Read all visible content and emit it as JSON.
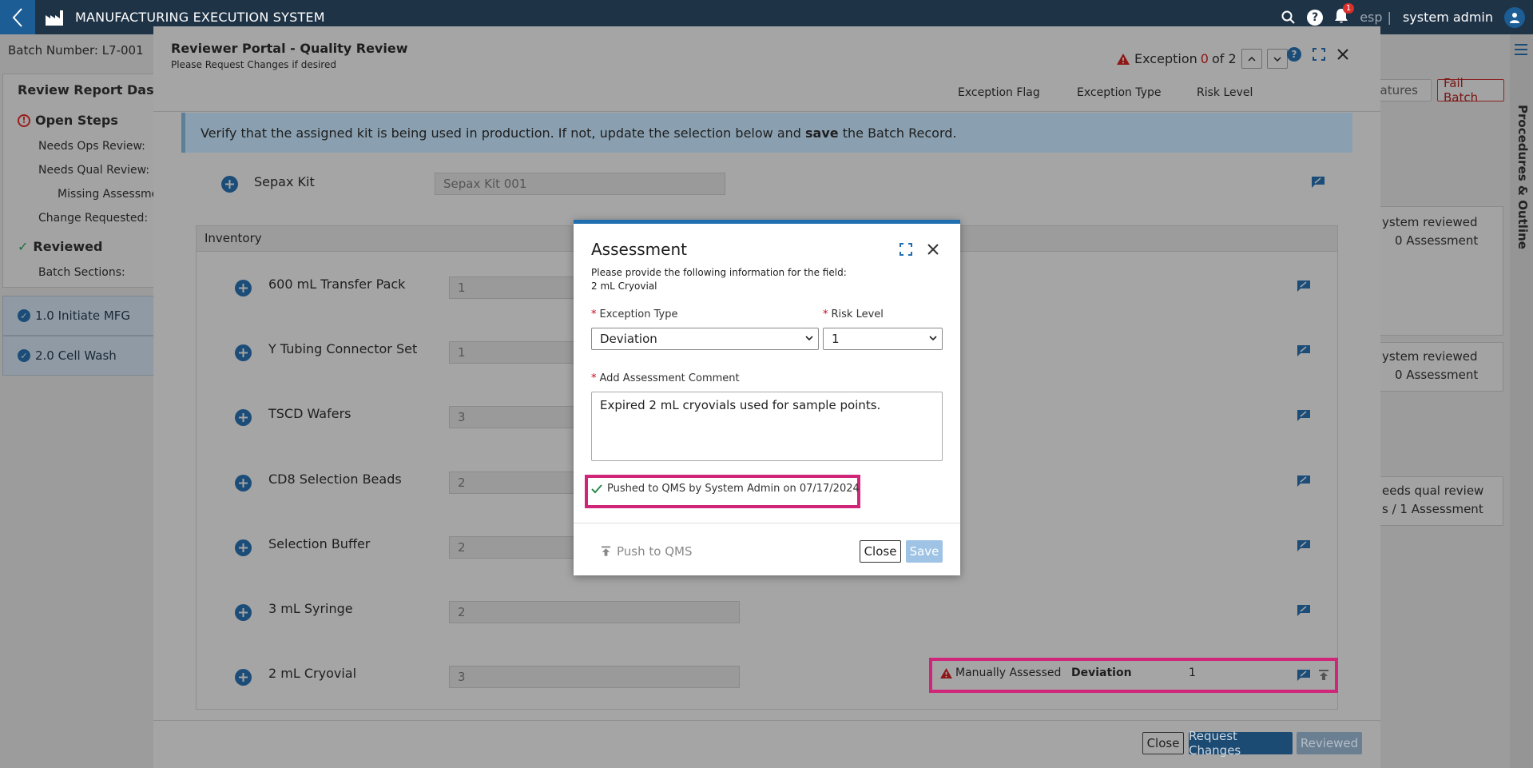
{
  "app": {
    "title": "MANUFACTURING EXECUTION SYSTEM",
    "lang": "esp",
    "separator": "|",
    "user": "system admin",
    "notifications": "1"
  },
  "background": {
    "batch": "Batch Number: L7-001",
    "dashboard_title": "Review Report Dashboa",
    "open_steps": "Open Steps",
    "needs_ops": "Needs Ops Review:",
    "needs_qual": "Needs Qual Review:",
    "missing": "Missing Assessment",
    "change_req": "Change Requested:",
    "reviewed": "Reviewed",
    "batch_sections": "Batch Sections:",
    "sec1": "1.0 Initiate MFG",
    "sec2": "2.0 Cell Wash",
    "btn_signatures": "natures",
    "btn_fail": "Fail Batch",
    "side_label": "Procedures & Outline",
    "rp1a": "ystem reviewed",
    "rp1b": "0 Assessment",
    "rp2a": "ystem reviewed",
    "rp2b": "0 Assessment",
    "rp3a": "eeds qual review",
    "rp3b": "s / 1 Assessment"
  },
  "portal": {
    "title": "Reviewer Portal - Quality Review",
    "subtitle": "Please Request Changes if desired",
    "exception_label": "Exception",
    "exception_current": "0",
    "exception_of": "of 2",
    "col_flag": "Exception Flag",
    "col_type": "Exception Type",
    "col_risk": "Risk Level",
    "banner_pre": "Verify that the assigned kit is being used in production. If not, update the selection below and",
    "banner_bold": "save",
    "banner_post": "the Batch Record.",
    "sepax_label": "Sepax Kit",
    "sepax_value": "Sepax Kit 001",
    "inventory_title": "Inventory",
    "items": [
      {
        "label": "600 mL Transfer Pack",
        "value": "1"
      },
      {
        "label": "Y Tubing Connector Set",
        "value": "1"
      },
      {
        "label": "TSCD Wafers",
        "value": "3"
      },
      {
        "label": "CD8 Selection Beads",
        "value": "2"
      },
      {
        "label": "Selection Buffer",
        "value": "2"
      },
      {
        "label": "3 mL Syringe",
        "value": "2"
      },
      {
        "label": "2 mL Cryovial",
        "value": "3"
      }
    ],
    "flag_text": "Manually Assessed",
    "flag_type": "Deviation",
    "flag_risk": "1",
    "footer_close": "Close",
    "footer_request": "Request Changes",
    "footer_reviewed": "Reviewed"
  },
  "dialog": {
    "title": "Assessment",
    "desc1": "Please provide the following information for the field:",
    "desc2": "2 mL Cryovial",
    "exc_type_label": "Exception Type",
    "exc_type_value": "Deviation",
    "risk_label": "Risk Level",
    "risk_value": "1",
    "comment_label": "Add Assessment Comment",
    "comment": "Expired 2 mL cryovials used for sample points.",
    "pushed": "Pushed to QMS by System Admin on 07/17/2024",
    "push_btn": "Push to QMS",
    "close_btn": "Close",
    "save_btn": "Save"
  },
  "colors": {
    "accent": "#1f6eb0",
    "highlight": "#d0267a",
    "alert": "#d0021b"
  }
}
